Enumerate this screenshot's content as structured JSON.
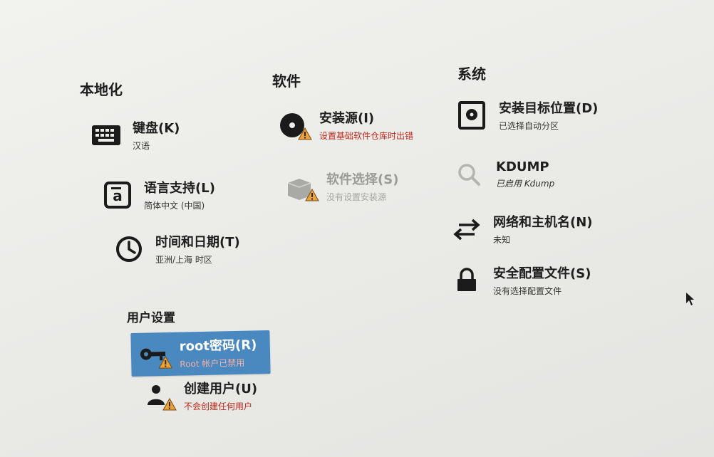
{
  "sections": {
    "localization": "本地化",
    "software": "软件",
    "system": "系统",
    "user_settings": "用户设置"
  },
  "localization": {
    "keyboard": {
      "title": "键盘(K)",
      "status": "汉语"
    },
    "language": {
      "title": "语言支持(L)",
      "status": "简体中文 (中国)"
    },
    "time": {
      "title": "时间和日期(T)",
      "status": "亚洲/上海 时区"
    }
  },
  "software": {
    "source": {
      "title": "安装源(I)",
      "status": "设置基础软件仓库时出错"
    },
    "selection": {
      "title": "软件选择(S)",
      "status": "没有设置安装源"
    }
  },
  "system": {
    "destination": {
      "title": "安装目标位置(D)",
      "status": "已选择自动分区"
    },
    "kdump": {
      "title": "KDUMP",
      "status": "已启用 Kdump"
    },
    "network": {
      "title": "网络和主机名(N)",
      "status": "未知"
    },
    "security": {
      "title": "安全配置文件(S)",
      "status": "没有选择配置文件"
    }
  },
  "user": {
    "root": {
      "title": "root密码(R)",
      "status": "Root 帐户已禁用"
    },
    "create": {
      "title": "创建用户(U)",
      "status": "不会创建任何用户"
    }
  },
  "colors": {
    "selected_bg": "#4a88c0",
    "error_text": "#c0281c",
    "warning": "#e8a33a"
  }
}
